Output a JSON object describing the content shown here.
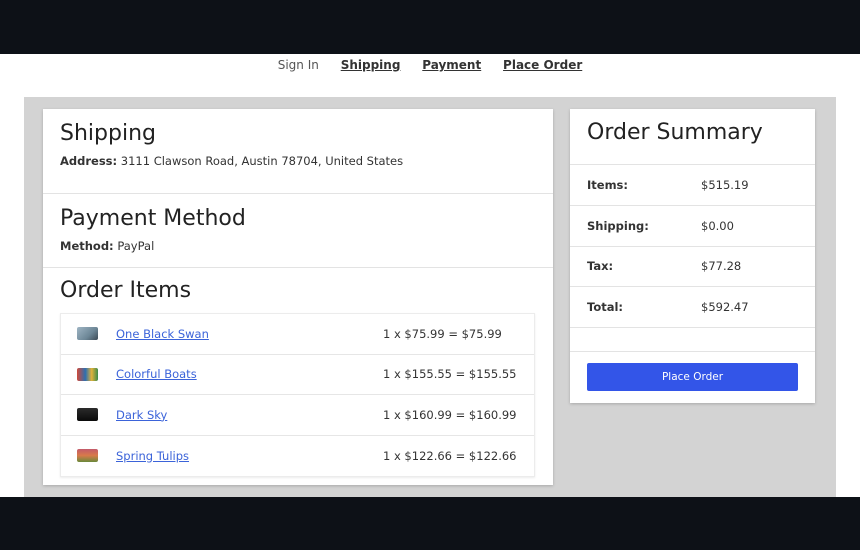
{
  "steps": [
    {
      "label": "Sign In",
      "state": "inactive"
    },
    {
      "label": "Shipping",
      "state": "active"
    },
    {
      "label": "Payment",
      "state": "active"
    },
    {
      "label": "Place Order",
      "state": "active"
    }
  ],
  "shipping": {
    "title": "Shipping",
    "address_label": "Address:",
    "address_value": "3111 Clawson Road, Austin 78704, United States"
  },
  "payment": {
    "title": "Payment Method",
    "method_label": "Method:",
    "method_value": "PayPal"
  },
  "order_items": {
    "title": "Order Items",
    "items": [
      {
        "name": "One Black Swan",
        "price_line": "1 x $75.99 = $75.99"
      },
      {
        "name": "Colorful Boats",
        "price_line": "1 x $155.55 = $155.55"
      },
      {
        "name": "Dark Sky",
        "price_line": "1 x $160.99 = $160.99"
      },
      {
        "name": "Spring Tulips",
        "price_line": "1 x $122.66 = $122.66"
      }
    ]
  },
  "summary": {
    "title": "Order Summary",
    "rows": [
      {
        "label": "Items:",
        "value": "$515.19"
      },
      {
        "label": "Shipping:",
        "value": "$0.00"
      },
      {
        "label": "Tax:",
        "value": "$77.28"
      },
      {
        "label": "Total:",
        "value": "$592.47"
      }
    ],
    "button_label": "Place Order"
  },
  "colors": {
    "accent": "#3355e8",
    "link": "#3b63d9",
    "content_background": "#d3d3d3",
    "frame": "#0d1117"
  }
}
